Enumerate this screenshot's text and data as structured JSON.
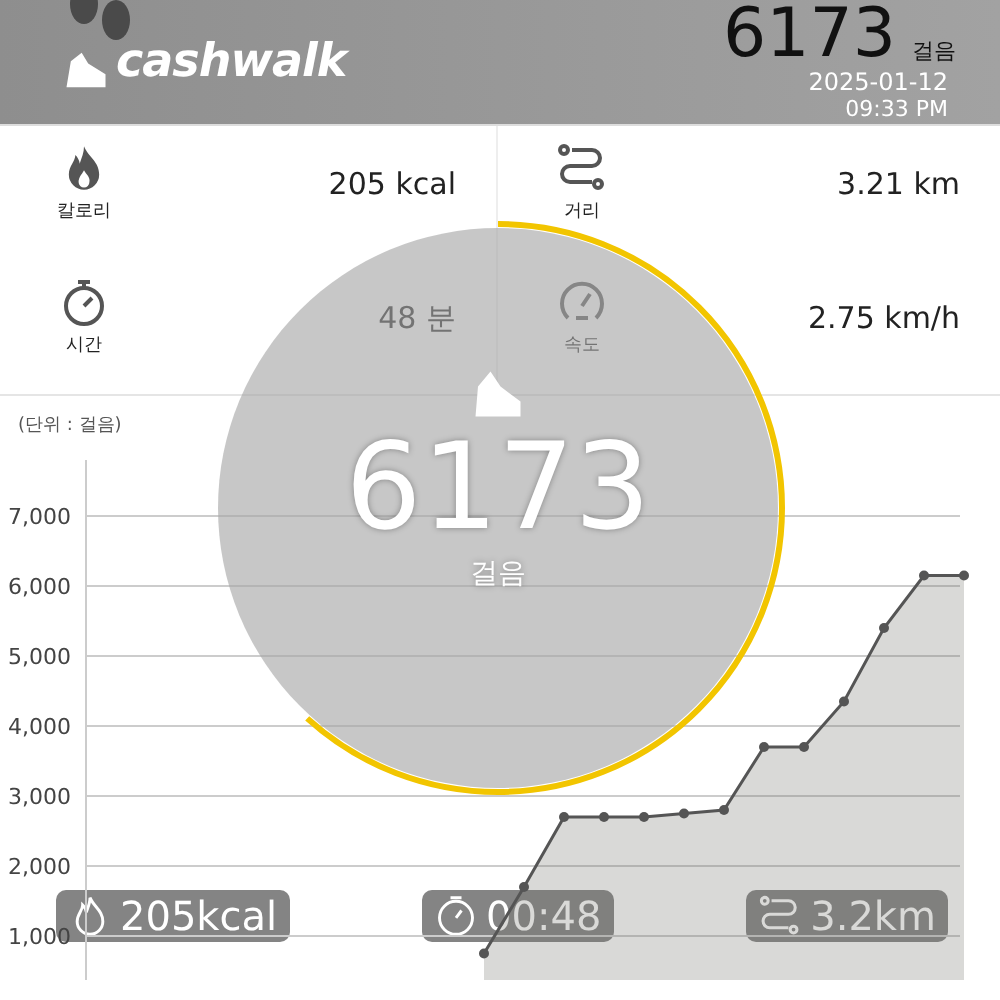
{
  "header": {
    "logo_text": "cashwalk",
    "steps": "6173",
    "steps_unit": "걸음",
    "date": "2025-01-12",
    "time": "09:33 PM"
  },
  "stats": [
    {
      "kind": "calories",
      "label": "칼로리",
      "value": "205 kcal"
    },
    {
      "kind": "distance",
      "label": "거리",
      "value": "3.21 km"
    },
    {
      "kind": "time",
      "label": "시간",
      "value": "48 분"
    },
    {
      "kind": "speed",
      "label": "속도",
      "value": "2.75 km/h"
    }
  ],
  "chart": {
    "unit_label": "(단위 : 걸음)",
    "chart_data": {
      "type": "area",
      "grid": true,
      "ylim": [
        0,
        7000
      ],
      "yticks": [
        {
          "value": 1000,
          "label": "1,000"
        },
        {
          "value": 2000,
          "label": "2,000"
        },
        {
          "value": 3000,
          "label": "3,000"
        },
        {
          "value": 4000,
          "label": "4,000"
        },
        {
          "value": 5000,
          "label": "5,000"
        },
        {
          "value": 6000,
          "label": "6,000"
        },
        {
          "value": 7000,
          "label": "7,000"
        }
      ],
      "series": [
        {
          "color": "#555555",
          "values": [
            750,
            1700,
            2700,
            2700,
            2700,
            2750,
            2800,
            3700,
            3700,
            4350,
            5400,
            6150,
            6150
          ]
        }
      ]
    }
  },
  "overlay": {
    "steps": "6173",
    "unit": "걸음",
    "level": 0.617
  },
  "summary": [
    {
      "kind": "calories",
      "text": "205kcal"
    },
    {
      "kind": "time",
      "text": "00:48"
    },
    {
      "kind": "distance",
      "text": "3.2km"
    }
  ]
}
